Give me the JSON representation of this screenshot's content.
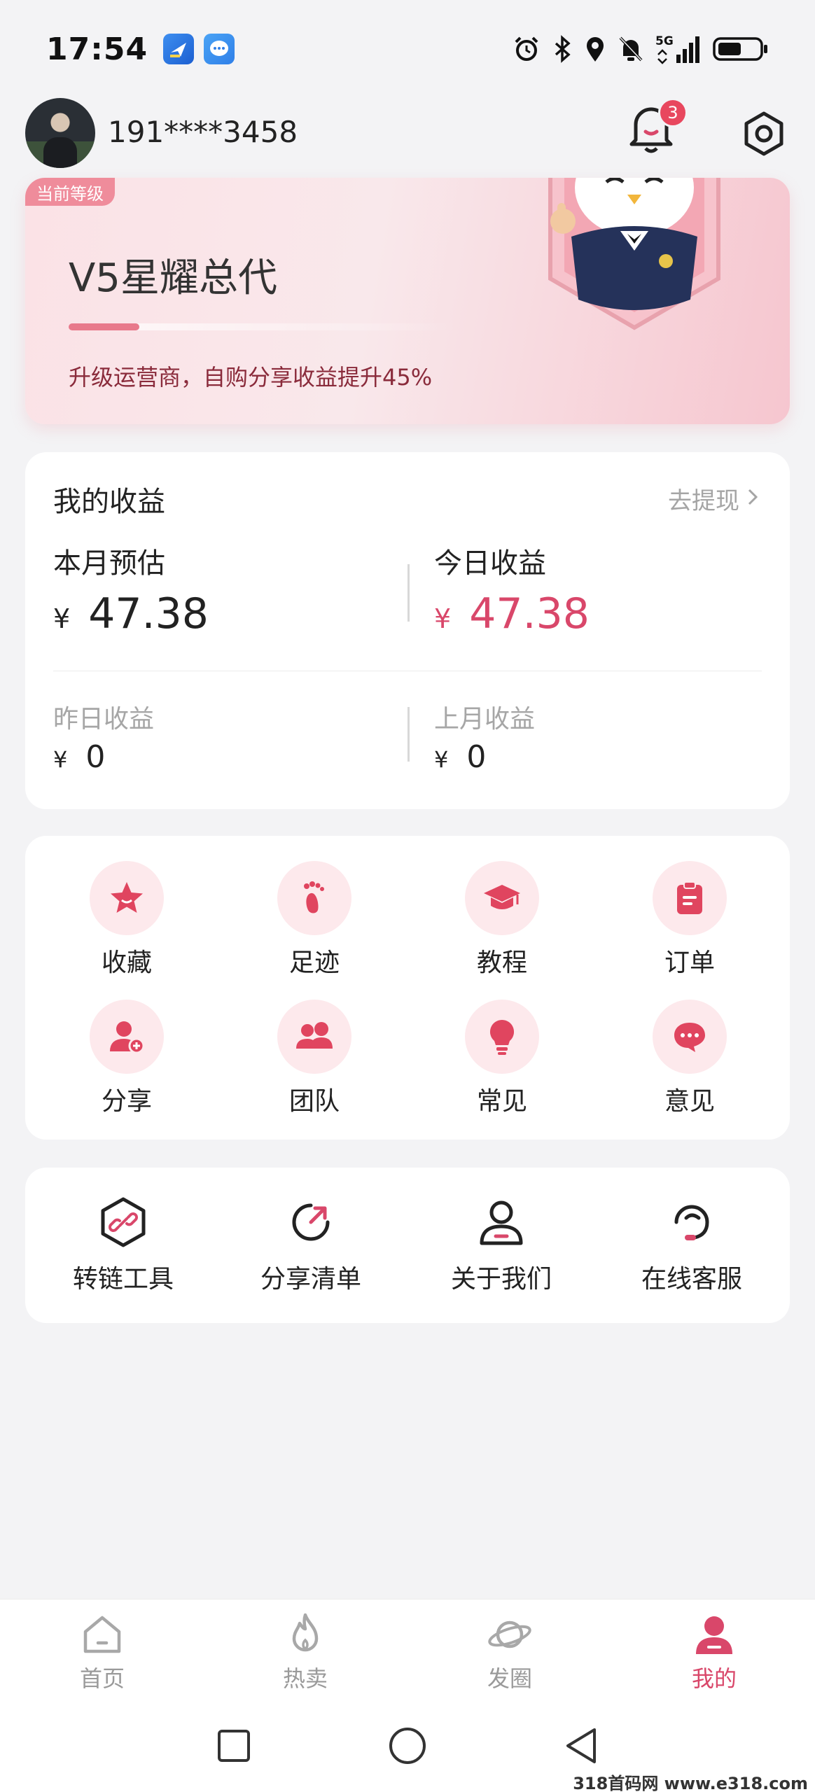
{
  "status_bar": {
    "time": "17:54",
    "icons": [
      "app-notification-icon",
      "message-app-icon",
      "alarm-icon",
      "bluetooth-icon",
      "location-icon",
      "mute-icon",
      "signal-5g-icon",
      "battery-icon"
    ],
    "network": "5G"
  },
  "header": {
    "phone": "191****3458",
    "notification_count": "3"
  },
  "level": {
    "tag": "当前等级",
    "name": "V5星耀总代",
    "progress": 0.18,
    "hint": "升级运营商，自购分享收益提升45%"
  },
  "earnings": {
    "title": "我的收益",
    "withdraw": "去提现",
    "currency": "¥",
    "month_est_label": "本月预估",
    "month_est_value": "47.38",
    "today_label": "今日收益",
    "today_value": "47.38",
    "yesterday_label": "昨日收益",
    "yesterday_value": "0",
    "last_month_label": "上月收益",
    "last_month_value": "0"
  },
  "grid": {
    "items": [
      {
        "label": "收藏",
        "icon": "star-icon"
      },
      {
        "label": "足迹",
        "icon": "footprint-icon"
      },
      {
        "label": "教程",
        "icon": "graduation-cap-icon"
      },
      {
        "label": "订单",
        "icon": "clipboard-icon"
      },
      {
        "label": "分享",
        "icon": "user-add-icon"
      },
      {
        "label": "团队",
        "icon": "team-icon"
      },
      {
        "label": "常见",
        "icon": "lightbulb-icon"
      },
      {
        "label": "意见",
        "icon": "chat-bubble-icon"
      }
    ]
  },
  "tools": {
    "items": [
      {
        "label": "转链工具",
        "icon": "link-icon"
      },
      {
        "label": "分享清单",
        "icon": "share-list-icon"
      },
      {
        "label": "关于我们",
        "icon": "person-icon"
      },
      {
        "label": "在线客服",
        "icon": "headset-icon"
      }
    ]
  },
  "bottom_nav": {
    "items": [
      {
        "label": "首页",
        "icon": "home-icon"
      },
      {
        "label": "热卖",
        "icon": "fire-icon"
      },
      {
        "label": "发圈",
        "icon": "planet-icon"
      },
      {
        "label": "我的",
        "icon": "profile-icon",
        "active": true
      }
    ]
  },
  "watermark": "318首码网 www.e318.com",
  "colors": {
    "accent": "#d9476a",
    "accent_light": "#fde9ec",
    "card_bg": "#ffffff",
    "page_bg": "#f3f3f5"
  }
}
